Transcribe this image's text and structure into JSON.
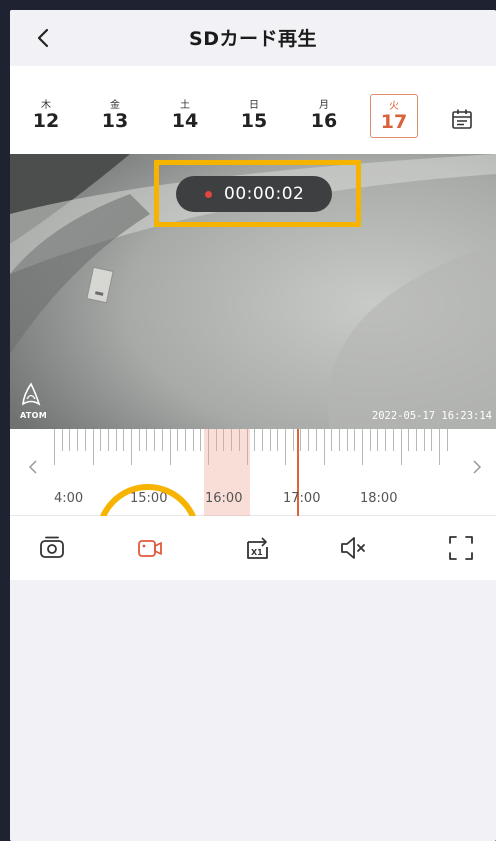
{
  "header": {
    "title": "SDカード再生",
    "back_icon": "chevron-left-icon"
  },
  "dates": [
    {
      "weekday": "木",
      "day": "12",
      "selected": false
    },
    {
      "weekday": "金",
      "day": "13",
      "selected": false
    },
    {
      "weekday": "土",
      "day": "14",
      "selected": false
    },
    {
      "weekday": "日",
      "day": "15",
      "selected": false
    },
    {
      "weekday": "月",
      "day": "16",
      "selected": false
    },
    {
      "weekday": "火",
      "day": "17",
      "selected": true
    }
  ],
  "calendar_icon": "calendar-icon",
  "video": {
    "recording_time": "00:00:02",
    "brand_text": "ATOM",
    "timestamp": "2022-05-17 16:23:14"
  },
  "timeline": {
    "labels": [
      "4:00",
      "15:00",
      "16:00",
      "17:00",
      "18:00"
    ],
    "accent_color": "#e0623a"
  },
  "toolbar": {
    "items": [
      {
        "icon": "snapshot-camera-icon"
      },
      {
        "icon": "video-record-icon"
      },
      {
        "icon": "playback-speed-x1-icon"
      },
      {
        "icon": "speaker-muted-icon"
      },
      {
        "icon": "fullscreen-icon"
      }
    ],
    "speed_label": "X1"
  },
  "colors": {
    "highlight_yellow": "#f6b400",
    "accent_red": "#d9623a",
    "background": "#f2f2f6"
  }
}
